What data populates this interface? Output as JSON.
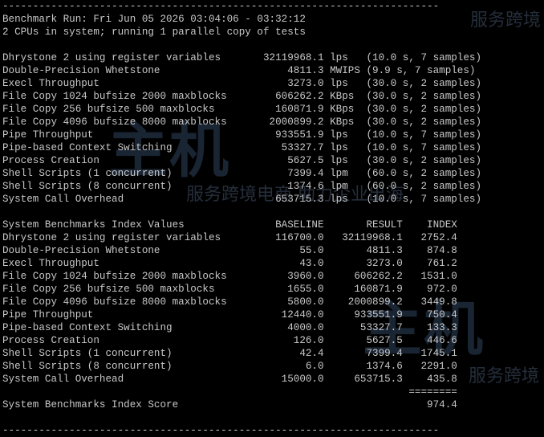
{
  "terminal": {
    "lines": [
      "------------------------------------------------------------------------",
      "Benchmark Run: Fri Jun 05 2026 03:04:06 - 03:32:12",
      "2 CPUs in system; running 1 parallel copy of tests",
      "",
      "Dhrystone 2 using register variables       32119968.1 lps   (10.0 s, 7 samples)",
      "Double-Precision Whetstone                     4811.3 MWIPS (9.9 s, 7 samples)",
      "Execl Throughput                               3273.0 lps   (30.0 s, 2 samples)",
      "File Copy 1024 bufsize 2000 maxblocks        606262.2 KBps  (30.0 s, 2 samples)",
      "File Copy 256 bufsize 500 maxblocks          160871.9 KBps  (30.0 s, 2 samples)",
      "File Copy 4096 bufsize 8000 maxblocks       2000899.2 KBps  (30.0 s, 2 samples)",
      "Pipe Throughput                              933551.9 lps   (10.0 s, 7 samples)",
      "Pipe-based Context Switching                  53327.7 lps   (10.0 s, 7 samples)",
      "Process Creation                               5627.5 lps   (30.0 s, 2 samples)",
      "Shell Scripts (1 concurrent)                   7399.4 lpm   (60.0 s, 2 samples)",
      "Shell Scripts (8 concurrent)                   1374.6 lpm   (60.0 s, 2 samples)",
      "System Call Overhead                         653715.3 lps   (10.0 s, 7 samples)",
      "",
      "System Benchmarks Index Values               BASELINE       RESULT    INDEX",
      "Dhrystone 2 using register variables         116700.0   32119968.1   2752.4",
      "Double-Precision Whetstone                       55.0       4811.3    874.8",
      "Execl Throughput                                 43.0       3273.0    761.2",
      "File Copy 1024 bufsize 2000 maxblocks          3960.0     606262.2   1531.0",
      "File Copy 256 bufsize 500 maxblocks            1655.0     160871.9    972.0",
      "File Copy 4096 bufsize 8000 maxblocks          5800.0    2000899.2   3449.8",
      "Pipe Throughput                               12440.0     933551.9    750.4",
      "Pipe-based Context Switching                   4000.0      53327.7    133.3",
      "Process Creation                                126.0       5627.5    446.6",
      "Shell Scripts (1 concurrent)                     42.4       7399.4   1745.1",
      "Shell Scripts (8 concurrent)                      6.0       1374.6   2291.0",
      "System Call Overhead                          15000.0     653715.3    435.8",
      "                                                                   ========",
      "System Benchmarks Index Score                                         974.4",
      "",
      "------------------------------------------------------------------------"
    ]
  },
  "watermarks": {
    "texts": [
      "服务跨境",
      "服务跨境电商 助力企业出海",
      "服务跨境",
      "主机",
      "主机"
    ],
    "fill_color": "#1d2a3a",
    "text_color": "#2a3442"
  }
}
